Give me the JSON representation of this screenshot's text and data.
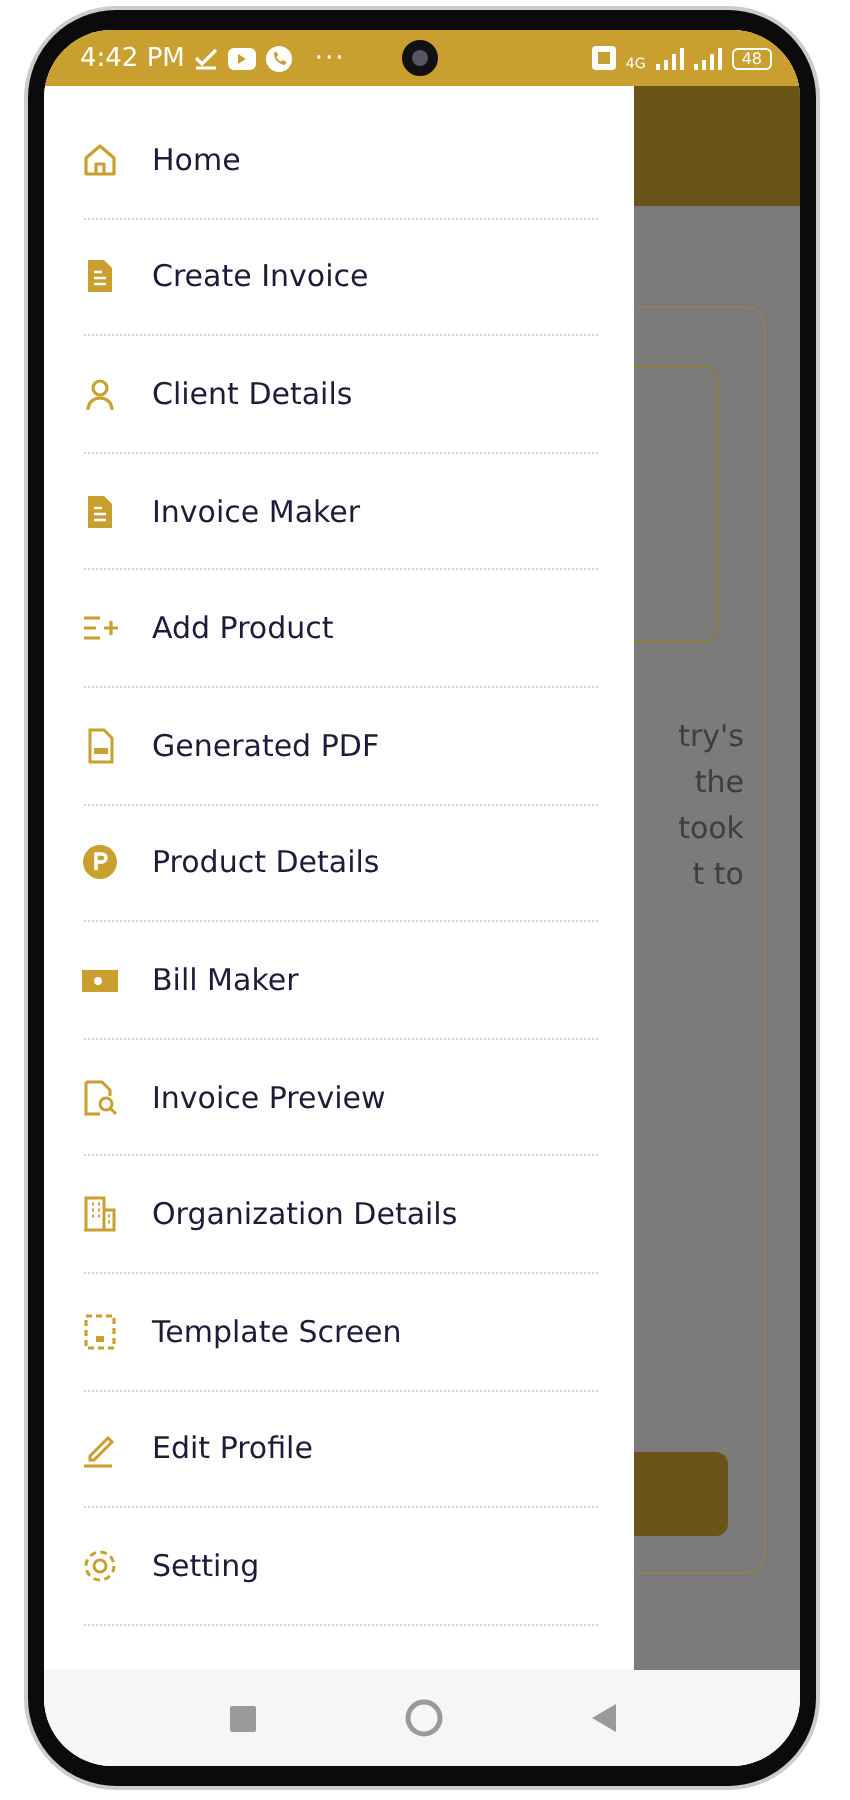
{
  "status_bar": {
    "time": "4:42 PM",
    "more": "···",
    "network": "4G",
    "battery": "48"
  },
  "drawer": {
    "items": [
      {
        "label": "Home"
      },
      {
        "label": "Create Invoice"
      },
      {
        "label": "Client Details"
      },
      {
        "label": "Invoice Maker"
      },
      {
        "label": "Add Product"
      },
      {
        "label": "Generated PDF"
      },
      {
        "label": "Product Details"
      },
      {
        "label": "Bill Maker"
      },
      {
        "label": "Invoice Preview"
      },
      {
        "label": "Organization Details"
      },
      {
        "label": "Template Screen"
      },
      {
        "label": "Edit Profile"
      },
      {
        "label": "Setting"
      }
    ]
  },
  "background": {
    "text_lines": [
      "try's",
      "the",
      "took",
      "t to"
    ]
  }
}
